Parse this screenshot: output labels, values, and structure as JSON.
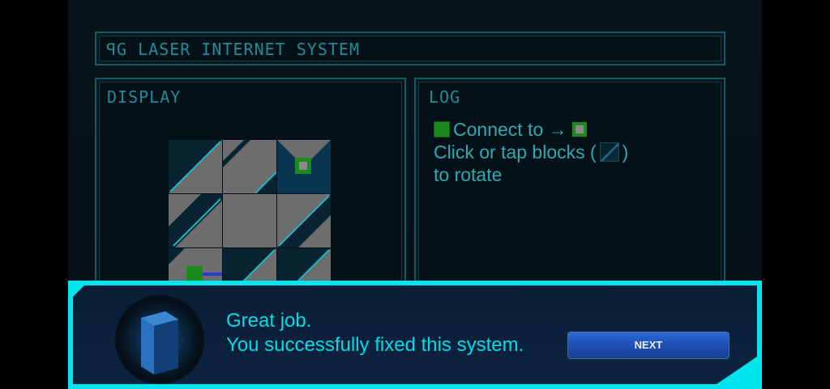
{
  "header": {
    "title": "ꟼG LASER INTERNET SYSTEM"
  },
  "display": {
    "title": "DISPLAY"
  },
  "log": {
    "title": "LOG",
    "line1": "Connect to →",
    "line2a": "Click or tap blocks (",
    "line2b": ")",
    "line3": "to rotate"
  },
  "dialog": {
    "line1": "Great job.",
    "line2": "You successfully fixed this system.",
    "next_label": "NEXT"
  },
  "colors": {
    "accent": "#00e5ee",
    "panel_border": "#0f5c66",
    "log_text": "#2ea9b2",
    "button": "#1f4fb4"
  }
}
